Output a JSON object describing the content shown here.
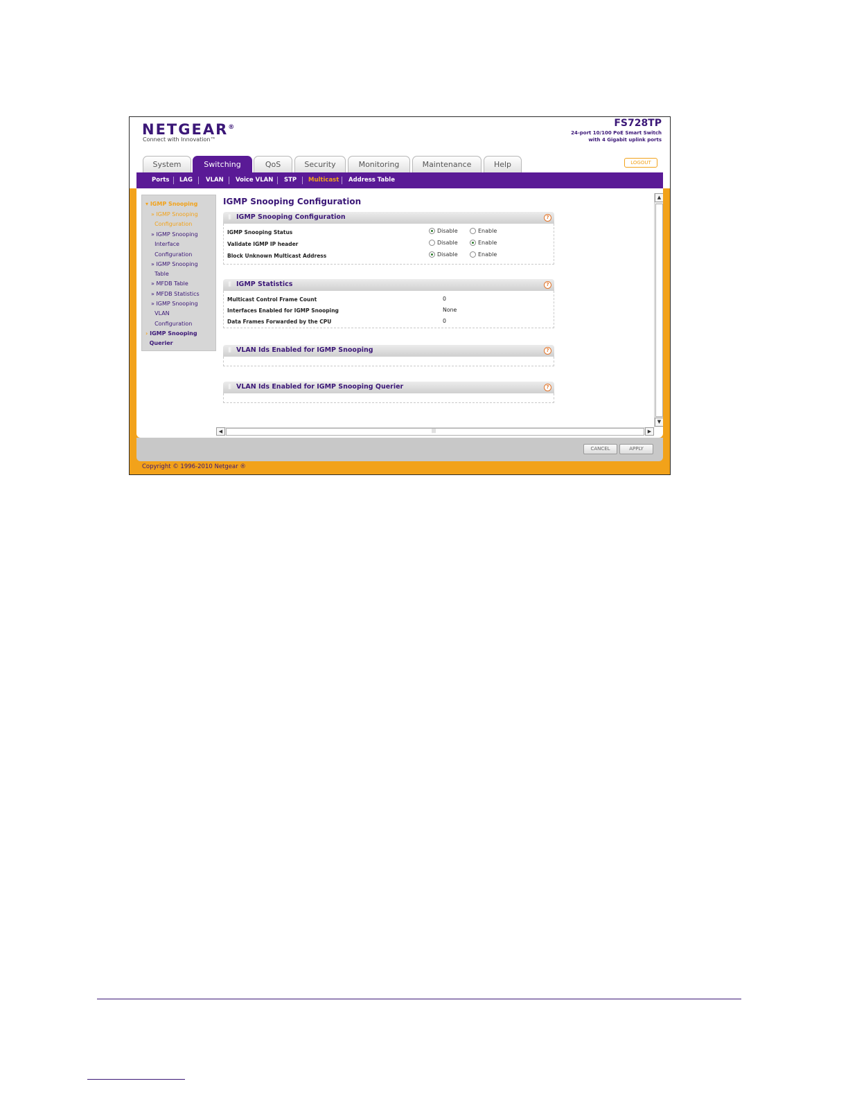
{
  "header": {
    "logo_text": "NETGEAR",
    "tagline": "Connect with Innovation™",
    "product_name": "FS728TP",
    "product_desc_line1": "24-port 10/100 PoE Smart Switch",
    "product_desc_line2": "with 4 Gigabit uplink ports",
    "logout_label": "LOGOUT"
  },
  "tabs": [
    "System",
    "Switching",
    "QoS",
    "Security",
    "Monitoring",
    "Maintenance",
    "Help"
  ],
  "active_tab": "Switching",
  "subnav": [
    "Ports",
    "LAG",
    "VLAN",
    "Voice VLAN",
    "STP",
    "Multicast",
    "Address Table"
  ],
  "active_subnav": "Multicast",
  "leftnav": {
    "section1": "IGMP Snooping",
    "items": [
      [
        "IGMP Snooping",
        "Configuration"
      ],
      [
        "IGMP Snooping",
        "Interface",
        "Configuration"
      ],
      [
        "IGMP Snooping",
        "Table"
      ],
      [
        "MFDB Table"
      ],
      [
        "MFDB Statistics"
      ],
      [
        "IGMP Snooping",
        "VLAN",
        "Configuration"
      ]
    ],
    "section2_line1": "IGMP Snooping",
    "section2_line2": "Querier"
  },
  "page_title": "IGMP Snooping Configuration",
  "config_box": {
    "title": "IGMP Snooping Configuration",
    "rows": [
      {
        "label": "IGMP Snooping Status",
        "selected": "Disable"
      },
      {
        "label": "Validate IGMP IP header",
        "selected": "Enable"
      },
      {
        "label": "Block Unknown Multicast Address",
        "selected": "Disable"
      }
    ],
    "option_disable": "Disable",
    "option_enable": "Enable"
  },
  "stats_box": {
    "title": "IGMP Statistics",
    "rows": [
      {
        "label": "Multicast Control Frame Count",
        "value": "0"
      },
      {
        "label": "Interfaces Enabled for IGMP Snooping",
        "value": "None"
      },
      {
        "label": "Data Frames Forwarded by the CPU",
        "value": "0"
      }
    ]
  },
  "vlan_box": {
    "title": "VLAN Ids Enabled for IGMP Snooping"
  },
  "querier_box": {
    "title": "VLAN Ids Enabled for IGMP Snooping Querier"
  },
  "help_glyph": "?",
  "buttons": {
    "cancel": "CANCEL",
    "apply": "APPLY"
  },
  "scroll_grip": "|||",
  "copyright": "Copyright © 1996-2010 Netgear ®"
}
